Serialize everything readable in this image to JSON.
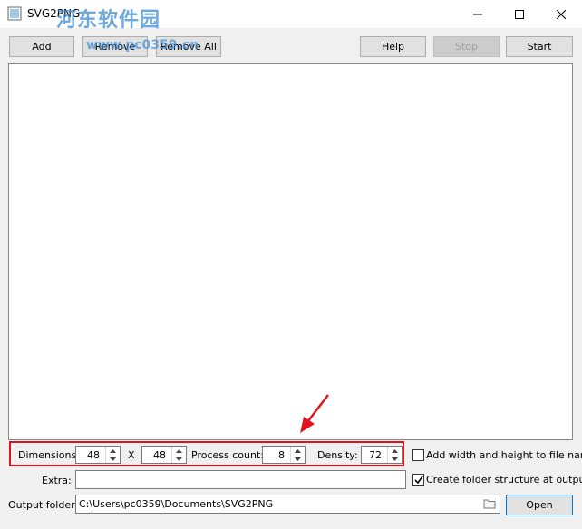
{
  "window": {
    "title": "SVG2PNG",
    "watermark": "河东软件园",
    "watermark_sub": "www.pc0359.cn"
  },
  "toolbar": {
    "add_label": "Add",
    "remove_label": "Remove",
    "remove_all_label": "Remove All",
    "help_label": "Help",
    "stop_label": "Stop",
    "start_label": "Start"
  },
  "settings": {
    "dimensions_label": "Dimensions:",
    "width": "48",
    "x_label": "X",
    "height": "48",
    "process_count_label": "Process count:",
    "process_count": "8",
    "density_label": "Density:",
    "density": "72",
    "add_size_checkbox_label": "Add width and height to file name",
    "add_size_checked": false,
    "folder_structure_checkbox_label": "Create folder structure at output",
    "folder_structure_checked": true,
    "extra_label": "Extra:",
    "extra_value": "",
    "output_folder_label": "Output folder:",
    "output_folder_value": "C:\\Users\\pc0359\\Documents\\SVG2PNG",
    "open_label": "Open"
  },
  "colors": {
    "highlight": "#e0141e",
    "arrow": "#e0141e"
  }
}
